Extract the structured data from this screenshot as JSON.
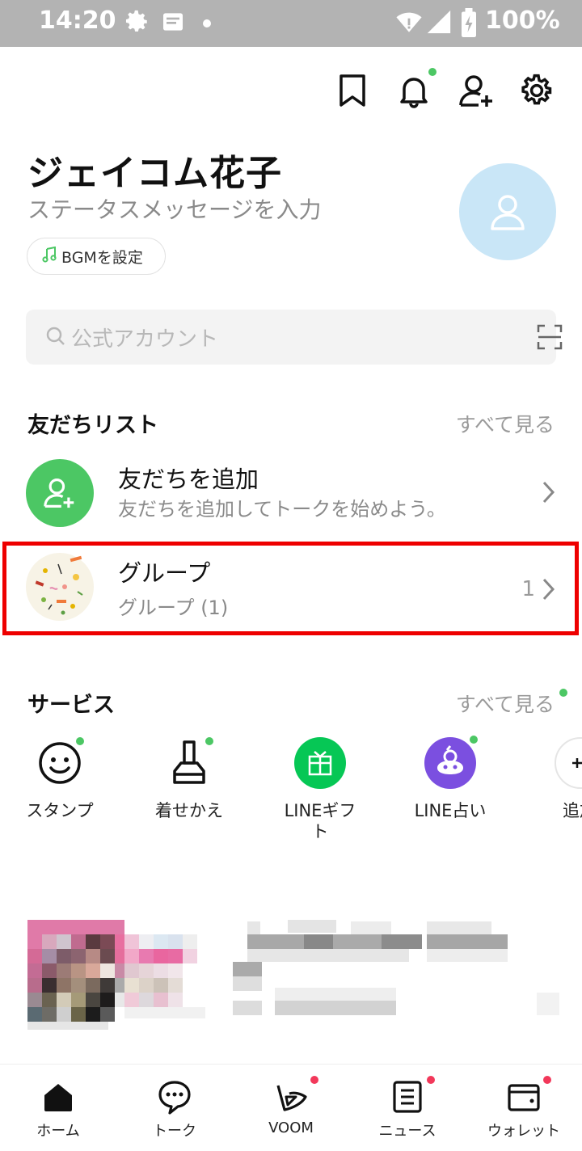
{
  "status_bar": {
    "time": "14:20",
    "battery": "100%"
  },
  "profile": {
    "name": "ジェイコム花子",
    "status_placeholder": "ステータスメッセージを入力",
    "bgm_label": "BGMを設定"
  },
  "search": {
    "placeholder": "公式アカウント"
  },
  "friends_section": {
    "title": "友だちリスト",
    "see_all": "すべて見る",
    "add_friend": {
      "title": "友だちを追加",
      "subtitle": "友だちを追加してトークを始めよう。"
    },
    "groups": {
      "title": "グループ",
      "subtitle": "グループ (1)",
      "count": "1"
    }
  },
  "services_section": {
    "title": "サービス",
    "see_all": "すべて見る",
    "items": [
      {
        "label": "スタンプ",
        "icon": "smiley-icon"
      },
      {
        "label": "着せかえ",
        "icon": "brush-icon"
      },
      {
        "label": "LINEギフ\nト",
        "icon": "gift-icon"
      },
      {
        "label": "LINE占い",
        "icon": "fortune-icon"
      },
      {
        "label": "追加",
        "icon": "plus-icon"
      }
    ]
  },
  "bottom_nav": {
    "items": [
      {
        "label": "ホーム",
        "icon": "home-icon"
      },
      {
        "label": "トーク",
        "icon": "chat-icon"
      },
      {
        "label": "VOOM",
        "icon": "voom-icon"
      },
      {
        "label": "ニュース",
        "icon": "news-icon"
      },
      {
        "label": "ウォレット",
        "icon": "wallet-icon"
      }
    ]
  },
  "colors": {
    "accent_green": "#4cc764",
    "notification_red": "#f2385a",
    "highlight_red": "#ee0000"
  }
}
